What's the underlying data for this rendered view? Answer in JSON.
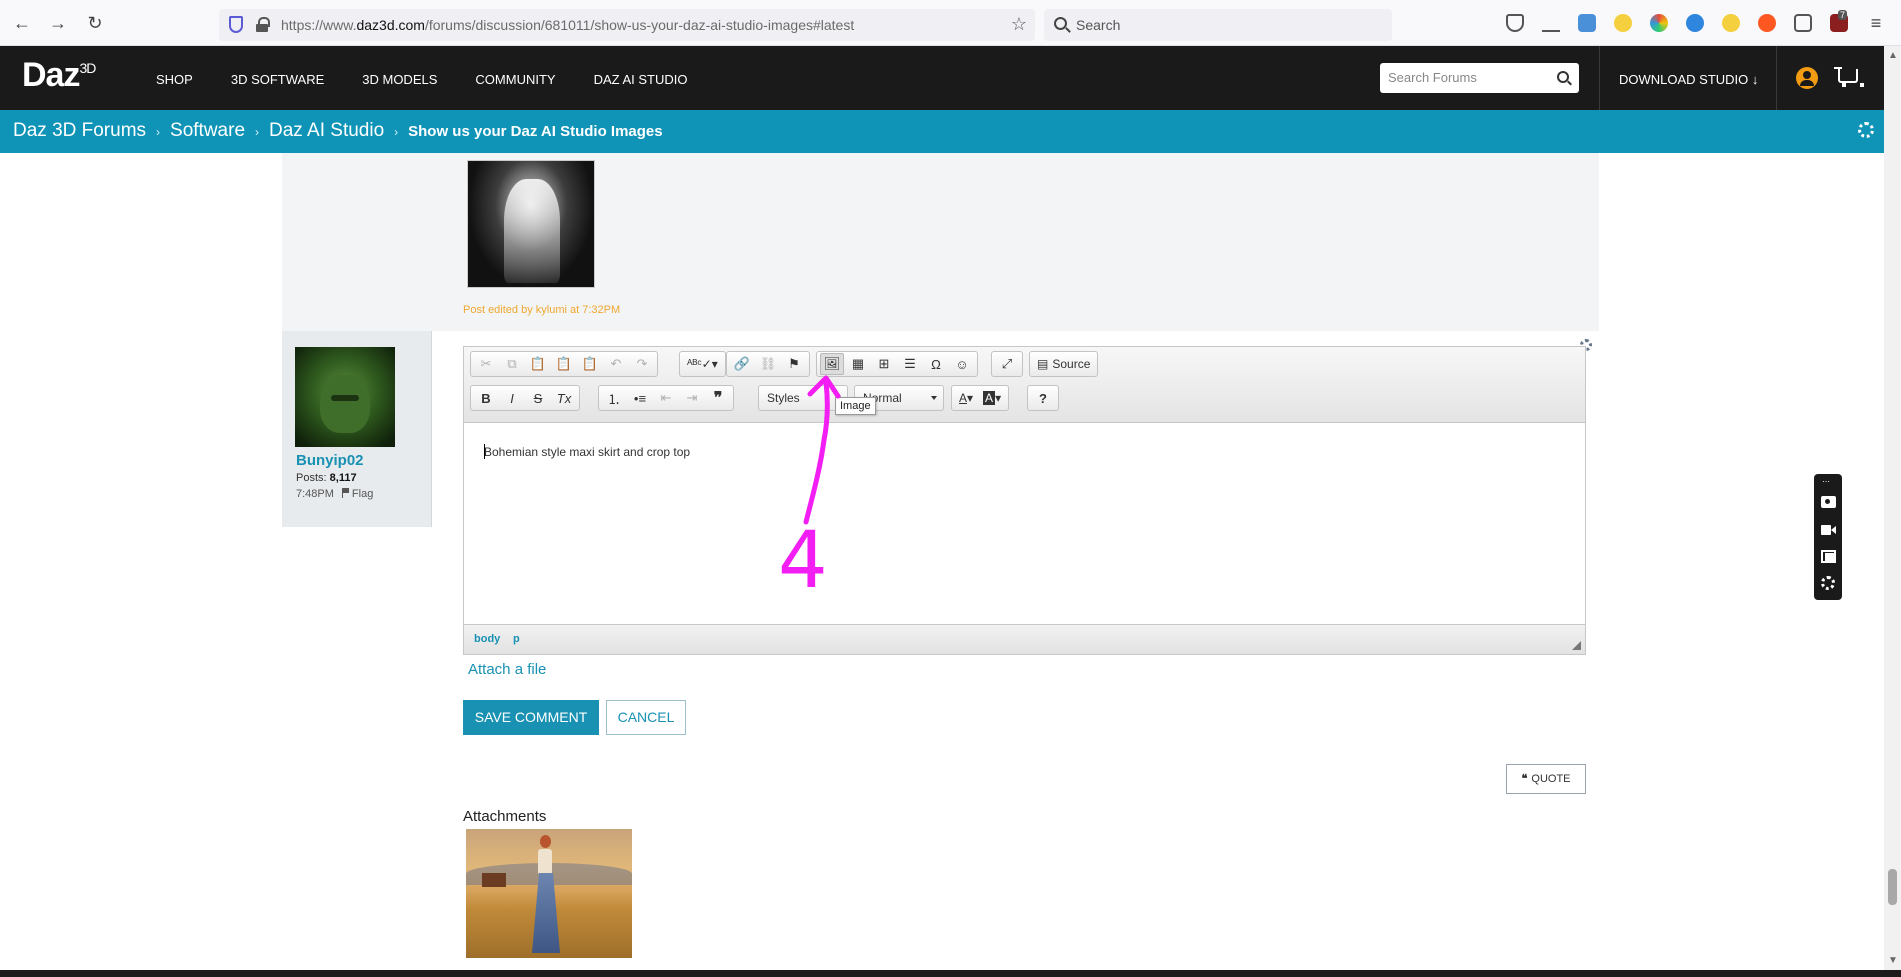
{
  "browser": {
    "url_prefix": "https://www.",
    "url_domain": "daz3d.com",
    "url_path": "/forums/discussion/681011/show-us-your-daz-ai-studio-images#latest",
    "search_placeholder": "Search",
    "notification_badge": "7"
  },
  "site": {
    "logo": "Daz",
    "logo_sup": "3D",
    "nav": [
      "SHOP",
      "3D SOFTWARE",
      "3D MODELS",
      "COMMUNITY",
      "DAZ AI STUDIO"
    ],
    "search_placeholder": "Search Forums",
    "download": "DOWNLOAD STUDIO ↓"
  },
  "breadcrumb": {
    "items": [
      "Daz 3D Forums",
      "Software",
      "Daz AI Studio"
    ],
    "separator": "›",
    "current": "Show us your Daz AI Studio Images"
  },
  "prev_post": {
    "edited_note": "Post edited by kylumi at 7:32PM"
  },
  "author": {
    "name": "Bunyip02",
    "posts_label": "Posts:",
    "posts": "8,117",
    "time": "7:48PM",
    "flag": "Flag"
  },
  "editor": {
    "toolbar": {
      "source": "Source",
      "styles": "Styles",
      "format": "Normal",
      "tooltip": "Image"
    },
    "content": "Bohemian style maxi skirt and crop top",
    "path": [
      "body",
      "p"
    ]
  },
  "actions": {
    "attach": "Attach a file",
    "save": "SAVE COMMENT",
    "cancel": "CANCEL",
    "quote": "QUOTE"
  },
  "attachments": {
    "title": "Attachments"
  },
  "annotation": {
    "number": "4",
    "color": "#f31ef3"
  },
  "colors": {
    "accent": "#0f94b8",
    "link": "#1991b3",
    "header": "#1a1a1a"
  }
}
